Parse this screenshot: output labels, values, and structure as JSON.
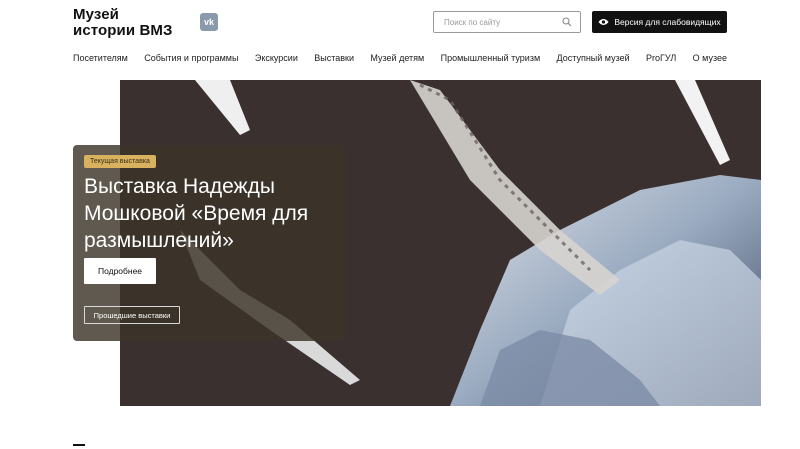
{
  "header": {
    "logo_line1": "Музей",
    "logo_line2": "истории ВМЗ",
    "vk_label": "vk",
    "search_placeholder": "Поиск по сайту",
    "vision_label": "Версия для слабовидящих"
  },
  "nav": {
    "items": [
      "Посетителям",
      "События и программы",
      "Экскурсии",
      "Выставки",
      "Музей детям",
      "Промышленный туризм",
      "Доступный музей",
      "ProГУЛ",
      "О музее"
    ]
  },
  "hero": {
    "badge": "Текущая выставка",
    "title": "Выставка Надежды Мошковой «Время для размышлений»",
    "more_label": "Подробнее",
    "past_label": "Прошедшие выставки"
  },
  "colors": {
    "accent_badge": "#d8b25e",
    "button_dark": "#111111",
    "hero_bg": "#3a302f"
  }
}
